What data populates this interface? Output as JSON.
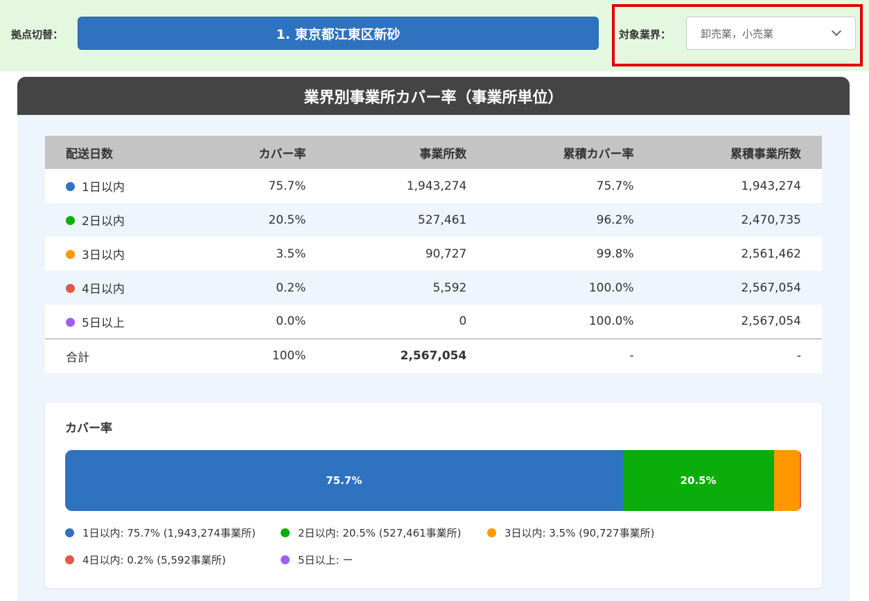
{
  "topbar": {
    "site_label": "拠点切替：",
    "site_value": "1. 東京都江東区新砂",
    "industry_label": "対象業界：",
    "industry_value": "卸売業，小売業"
  },
  "panel": {
    "title": "業界別事業所カバー率（事業所単位）"
  },
  "table": {
    "headers": [
      "配送日数",
      "カバー率",
      "事業所数",
      "累積カバー率",
      "累積事業所数"
    ],
    "rows": [
      {
        "label": "1日以内",
        "color": "#2f72c0",
        "rate": "75.7%",
        "count": "1,943,274",
        "cum_rate": "75.7%",
        "cum_count": "1,943,274"
      },
      {
        "label": "2日以内",
        "color": "#0aad0a",
        "rate": "20.5%",
        "count": "527,461",
        "cum_rate": "96.2%",
        "cum_count": "2,470,735"
      },
      {
        "label": "3日以内",
        "color": "#ff9800",
        "rate": "3.5%",
        "count": "90,727",
        "cum_rate": "99.8%",
        "cum_count": "2,561,462"
      },
      {
        "label": "4日以内",
        "color": "#e05a47",
        "rate": "0.2%",
        "count": "5,592",
        "cum_rate": "100.0%",
        "cum_count": "2,567,054"
      },
      {
        "label": "5日以上",
        "color": "#a45cf0",
        "rate": "0.0%",
        "count": "0",
        "cum_rate": "100.0%",
        "cum_count": "2,567,054"
      }
    ],
    "total": {
      "label": "合計",
      "rate": "100%",
      "count": "2,567,054",
      "cum_rate": "-",
      "cum_count": "-"
    }
  },
  "coverage_chart": {
    "title": "カバー率",
    "segments": [
      {
        "label": "1日以内",
        "percent": 75.7,
        "display": "75.7%",
        "color": "#2f72c0"
      },
      {
        "label": "2日以内",
        "percent": 20.5,
        "display": "20.5%",
        "color": "#0aad0a"
      },
      {
        "label": "3日以内",
        "percent": 3.5,
        "display": "",
        "color": "#ff9800"
      },
      {
        "label": "4日以内",
        "percent": 0.2,
        "display": "",
        "color": "#e05a47"
      },
      {
        "label": "5日以上",
        "percent": 0.0,
        "display": "",
        "color": "#a45cf0"
      }
    ],
    "legend": [
      {
        "text": "1日以内: 75.7% (1,943,274事業所)",
        "color": "#2f72c0"
      },
      {
        "text": "2日以内: 20.5% (527,461事業所)",
        "color": "#0aad0a"
      },
      {
        "text": "3日以内: 3.5% (90,727事業所)",
        "color": "#ff9800"
      },
      {
        "text": "4日以内: 0.2% (5,592事業所)",
        "color": "#e05a47"
      },
      {
        "text": "5日以上: ー",
        "color": "#a45cf0"
      }
    ]
  }
}
